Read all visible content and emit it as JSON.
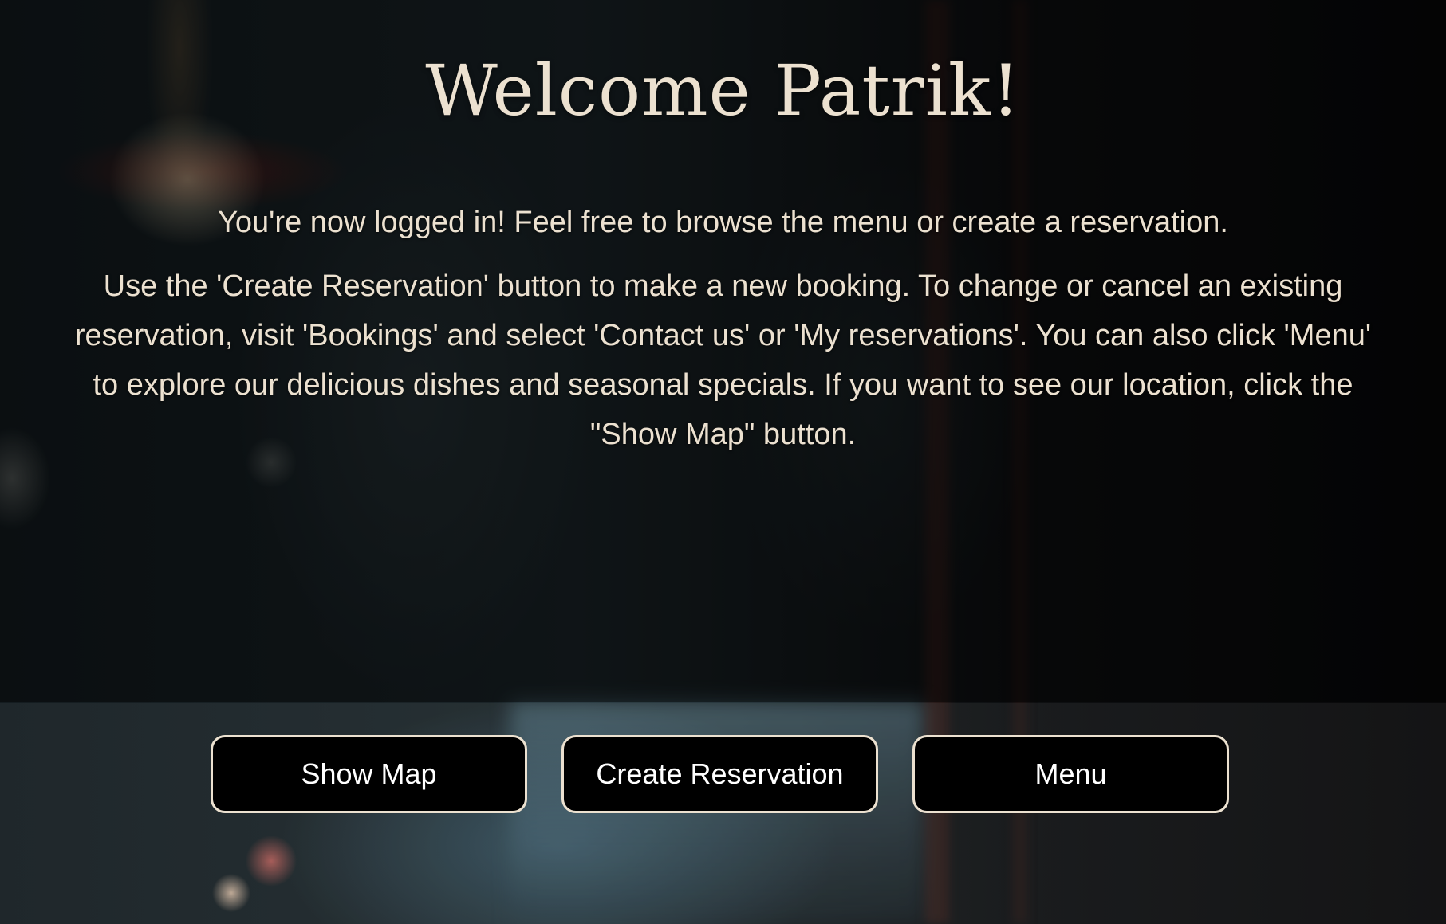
{
  "hero": {
    "title": "Welcome Patrik!",
    "lead": "You're now logged in! Feel free to browse the menu or create a reservation.",
    "instructions": "Use the 'Create Reservation' button to make a new booking. To change or cancel an existing reservation, visit 'Bookings' and select 'Contact us' or 'My reservations'. You can also click 'Menu' to explore our delicious dishes and seasonal specials. If you want to see our location, click the \"Show Map\" button."
  },
  "actions": {
    "show_map": "Show Map",
    "create_reservation": "Create Reservation",
    "menu": "Menu"
  },
  "colors": {
    "text": "#ece1d0",
    "button_background": "#000000",
    "button_text": "#ffffff",
    "button_border": "#ece1d0"
  }
}
